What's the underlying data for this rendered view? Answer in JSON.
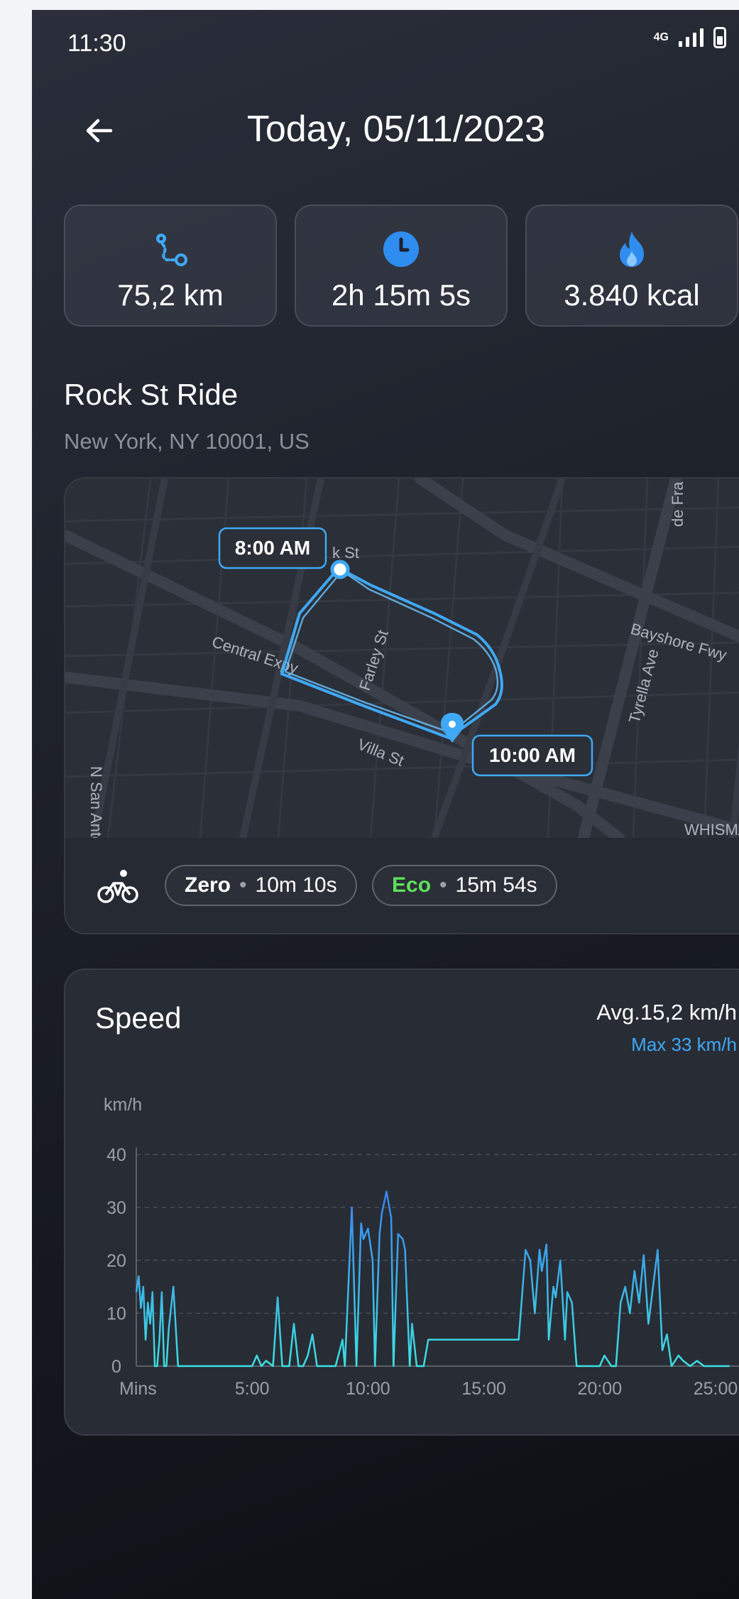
{
  "status_bar": {
    "time": "11:30",
    "network": "4G"
  },
  "header": {
    "title": "Today, 05/11/2023"
  },
  "stats": [
    {
      "icon": "route-icon",
      "value": "75,2 km"
    },
    {
      "icon": "clock-icon",
      "value": "2h 15m 5s"
    },
    {
      "icon": "flame-icon",
      "value": "3.840 kcal"
    }
  ],
  "ride": {
    "title": "Rock St Ride",
    "location": "New York, NY 10001, US",
    "start_label": "8:00 AM",
    "end_label": "10:00 AM",
    "map_labels": {
      "central": "Central Expy",
      "farley": "Farley St",
      "villa": "Villa St",
      "bayshore": "Bayshore Fwy",
      "tyrella": "Tyrella Ave",
      "sanantonio": "N San Anto",
      "whisman": "WHISMAN",
      "defrance": "de Fra",
      "rock": "k St"
    },
    "modes": [
      {
        "name": "Zero",
        "duration": "10m 10s"
      },
      {
        "name": "Eco",
        "duration": "15m 54s"
      }
    ]
  },
  "speed": {
    "title": "Speed",
    "avg": "Avg.15,2 km/h",
    "max": "Max 33 km/h",
    "unit": "km/h"
  },
  "colors": {
    "accent": "#3fa9f5",
    "eco": "#5ee05a",
    "line_bottom": "#3ce0e0",
    "line_top": "#3a7ef0"
  },
  "chart_data": {
    "type": "line",
    "title": "Speed",
    "ylabel": "km/h",
    "x_tick_labels": [
      "Mins",
      "5:00",
      "10:00",
      "15:00",
      "20:00",
      "25:00"
    ],
    "y_ticks": [
      0,
      10,
      20,
      30,
      40
    ],
    "ylim": [
      0,
      40
    ],
    "xlim": [
      0,
      26.5
    ],
    "grid": true,
    "series": [
      {
        "x": [
          0,
          0.1,
          0.2,
          0.3,
          0.4,
          0.5,
          0.6,
          0.7,
          0.8,
          0.9,
          1.0,
          1.1,
          1.2,
          1.3,
          1.4,
          1.6,
          1.8,
          1.9,
          2.0,
          2.1,
          2.3,
          2.5,
          2.6,
          2.7,
          2.9,
          3.0,
          3.4,
          4.7,
          5.0,
          5.2,
          5.4,
          5.6,
          5.9,
          6.1,
          6.3,
          6.6,
          6.8,
          7.0,
          7.2,
          7.4,
          7.6,
          7.8,
          8.0,
          8.3,
          8.6,
          8.9,
          9.0,
          9.3,
          9.5,
          9.7,
          9.8,
          10.0,
          10.2,
          10.3,
          10.5,
          10.6,
          10.8,
          11.0,
          11.1,
          11.3,
          11.5,
          11.6,
          11.8,
          11.9,
          12.1,
          12.3,
          12.4,
          12.6,
          12.8,
          13.0,
          16.5,
          16.8,
          17.0,
          17.2,
          17.4,
          17.5,
          17.7,
          17.8,
          18.0,
          18.1,
          18.3,
          18.5,
          18.6,
          18.8,
          19.0,
          19.2,
          19.4,
          20.0,
          20.2,
          20.5,
          20.7,
          20.9,
          21.1,
          21.3,
          21.5,
          21.7,
          21.9,
          22.1,
          22.3,
          22.5,
          22.7,
          22.9,
          23.1,
          23.4,
          23.6,
          23.9,
          24.2,
          24.5,
          25.6
        ],
        "y": [
          14,
          17,
          11,
          15,
          5,
          12,
          8,
          14,
          0,
          0,
          5,
          14,
          0,
          0,
          7,
          15,
          0,
          0,
          0,
          0,
          0,
          0,
          0,
          0,
          0,
          0,
          0,
          0,
          0,
          2,
          0,
          1,
          0,
          13,
          0,
          0,
          8,
          0,
          0,
          2,
          6,
          0,
          0,
          0,
          0,
          5,
          0,
          30,
          0,
          27,
          24,
          26,
          20,
          0,
          25,
          29,
          33,
          28,
          0,
          25,
          24,
          22,
          0,
          8,
          0,
          0,
          0,
          5,
          5,
          5,
          5,
          22,
          20,
          10,
          22,
          18,
          23,
          5,
          15,
          13,
          20,
          5,
          14,
          12,
          0,
          0,
          0,
          0,
          2,
          0,
          0,
          12,
          15,
          10,
          18,
          12,
          21,
          8,
          15,
          22,
          3,
          6,
          0,
          2,
          1,
          0,
          1,
          0,
          0
        ]
      }
    ]
  }
}
